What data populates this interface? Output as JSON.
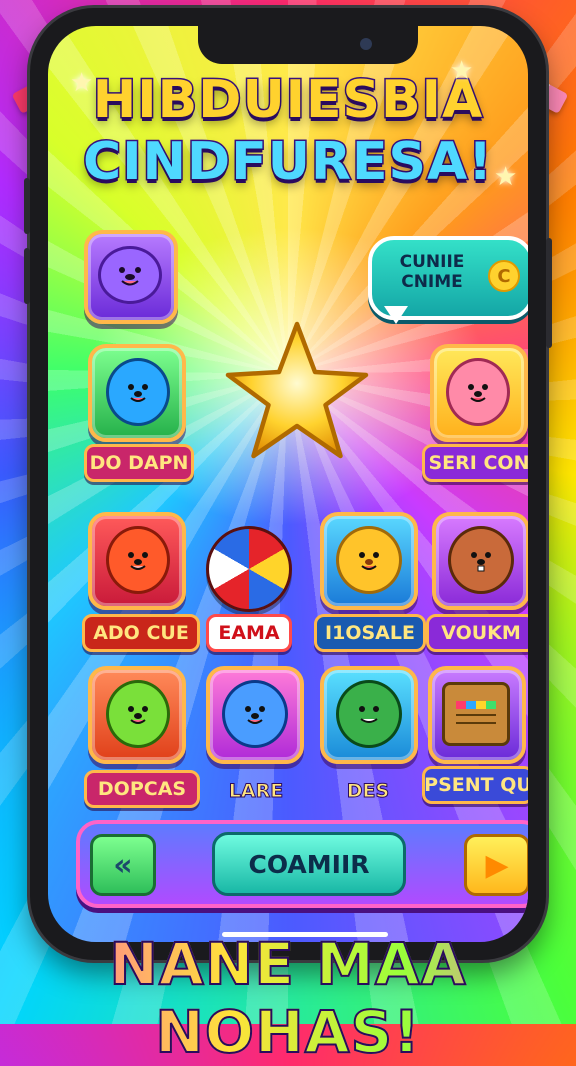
{
  "title": {
    "line1": "HIBDUIESBIA",
    "line2": "CINDFURESA!"
  },
  "speech_bubble": {
    "text": "CUNIIE CNIME",
    "coin_symbol": "C"
  },
  "apps": [
    {
      "label": "",
      "icon": "purple-seal-icon",
      "color": "#8b4dff"
    },
    {
      "label": "DO DAPN",
      "icon": "blue-bear-icon",
      "color": "#2aa8ff"
    },
    {
      "label": "SERI CON",
      "icon": "pink-bear-icon",
      "color": "#ff7aa8"
    },
    {
      "label": "ADO CUE",
      "icon": "red-bear-icon",
      "color": "#ff5a3a"
    },
    {
      "label": "EAMA",
      "icon": "beach-ball-icon",
      "color": "#e5242a"
    },
    {
      "label": "I1OSALE",
      "icon": "lion-icon",
      "color": "#ffc42a"
    },
    {
      "label": "VOUKM",
      "icon": "beaver-icon",
      "color": "#c96a3a"
    },
    {
      "label": "DOPCAS",
      "icon": "green-bear-icon",
      "color": "#6be03a"
    },
    {
      "label": "LARE",
      "icon": "blue-bear-ball-icon",
      "color": "#4a9dff"
    },
    {
      "label": "DES",
      "icon": "dinosaur-icon",
      "color": "#3ab04a"
    },
    {
      "label": "PSENT QU",
      "icon": "toy-box-icon",
      "color": "#c98a3a"
    }
  ],
  "bottom_bar": {
    "back_symbol": "«",
    "main_label": "COAMIIR",
    "next_symbol": "▶"
  },
  "footer": "NANE MAA NOHAS!"
}
